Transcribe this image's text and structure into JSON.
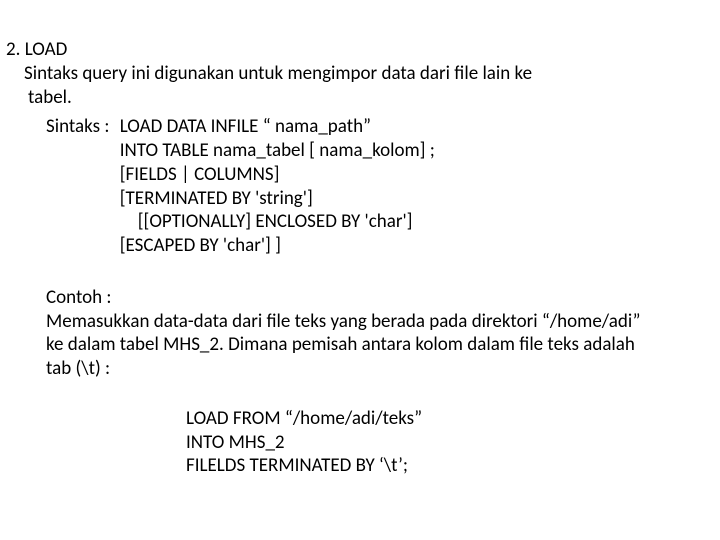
{
  "heading": {
    "num": "2. LOAD",
    "desc1": "Sintaks query ini digunakan untuk mengimpor data dari file lain ke",
    "desc2": "tabel."
  },
  "sintaks_label": "Sintaks :",
  "sintaks_lines": {
    "l1": "LOAD DATA INFILE “ nama_path”",
    "l2": "INTO TABLE nama_tabel [ nama_kolom] ;",
    "l3": "[FIELDS | COLUMNS]",
    "l4": "[TERMINATED BY 'string']",
    "l5": "[[OPTIONALLY] ENCLOSED BY 'char']",
    "l6": "[ESCAPED BY 'char'] ]"
  },
  "contoh": {
    "label": "Contoh :",
    "p1": "Memasukkan data-data dari file teks yang berada pada direktori “/home/adi”",
    "p2": "ke dalam tabel MHS_2. Dimana pemisah antara kolom dalam file teks adalah",
    "p3": "tab (\\t) :"
  },
  "example": {
    "e1": "LOAD FROM “/home/adi/teks”",
    "e2": "INTO MHS_2",
    "e3": "FILELDS TERMINATED BY ‘\\t’;"
  }
}
